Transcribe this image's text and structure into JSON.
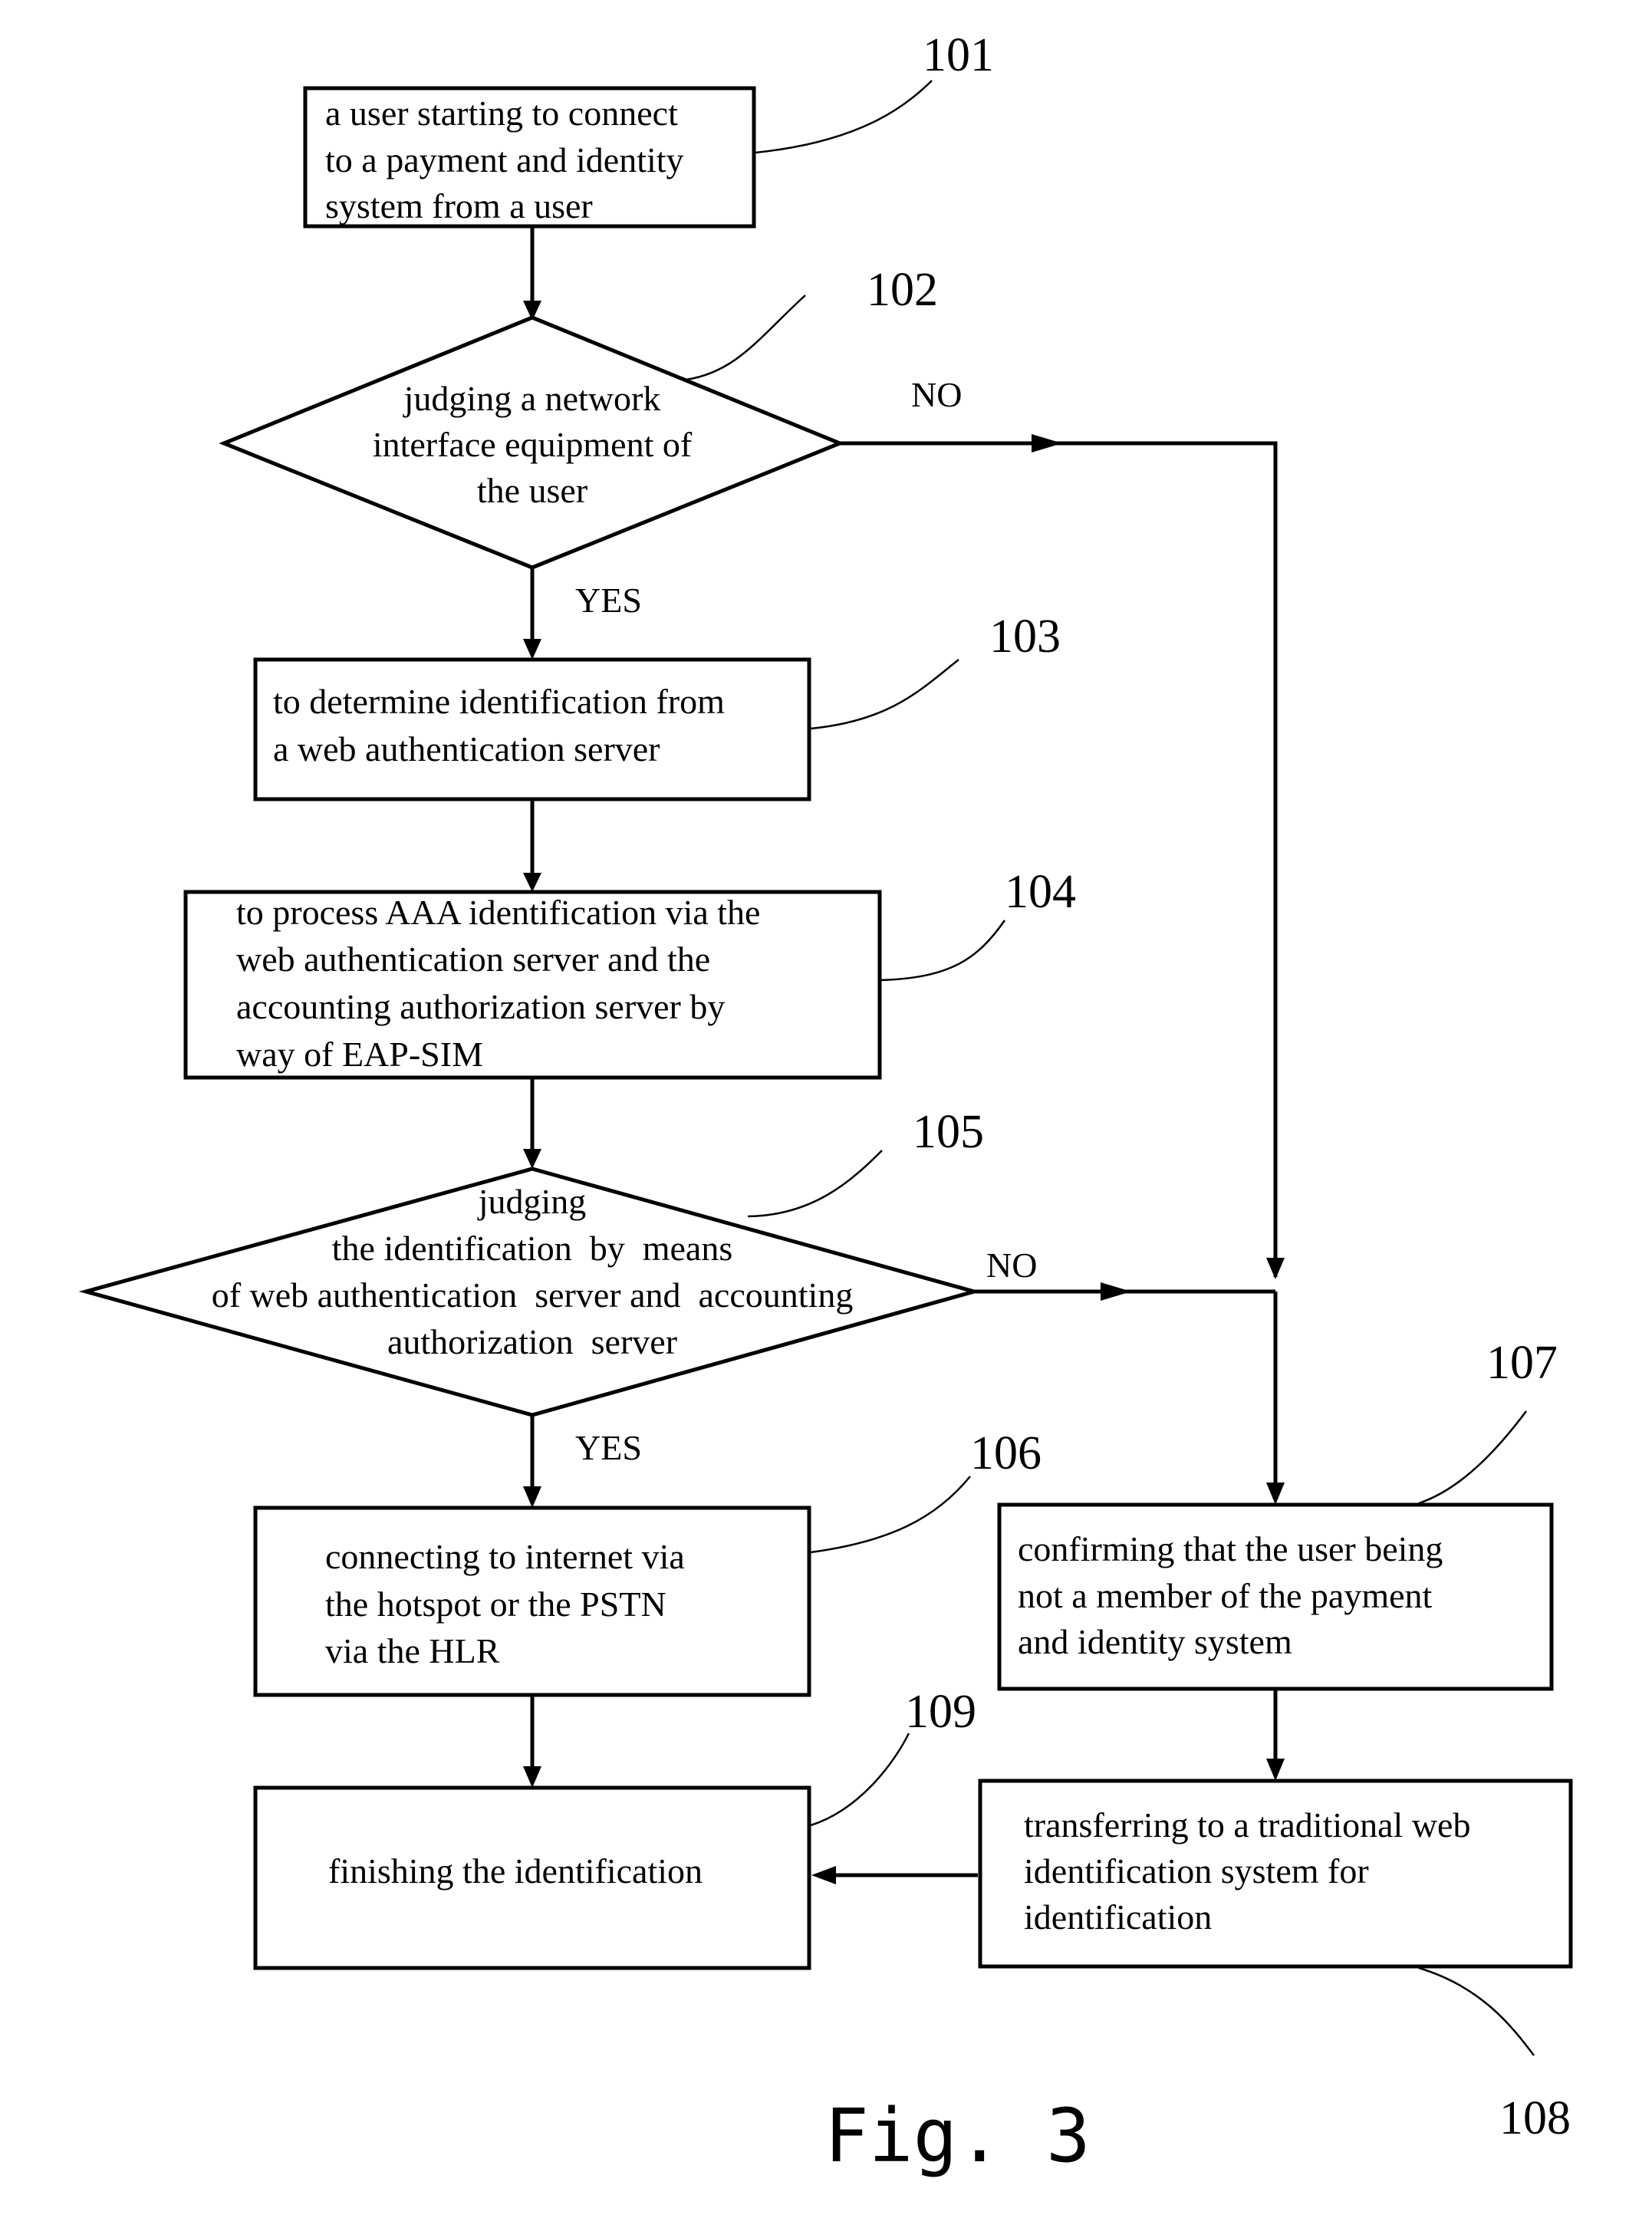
{
  "figure_label": "Fig. 3",
  "steps": {
    "s101": {
      "ref": "101",
      "lines": [
        "a user starting to connect",
        "to a payment and identity",
        "system from a user"
      ]
    },
    "s102": {
      "ref": "102",
      "lines": [
        "judging a network",
        "interface equipment of",
        "the user"
      ]
    },
    "s103": {
      "ref": "103",
      "lines": [
        "to determine identification from",
        "a web authentication server"
      ]
    },
    "s104": {
      "ref": "104",
      "lines": [
        "to process AAA identification via the",
        "web authentication server and the",
        "accounting authorization server by",
        "way of EAP-SIM"
      ]
    },
    "s105": {
      "ref": "105",
      "lines": [
        "judging",
        "the identification  by  means",
        "of web authentication  server and  accounting",
        "authorization  server"
      ]
    },
    "s106": {
      "ref": "106",
      "lines": [
        "connecting to internet via",
        "the hotspot or the PSTN",
        "via the HLR"
      ]
    },
    "s107": {
      "ref": "107",
      "lines": [
        "confirming that the user being",
        "not a member of the payment",
        "and identity system"
      ]
    },
    "s108": {
      "ref": "108",
      "lines": [
        "transferring to a traditional web",
        "identification system for",
        "identification"
      ]
    },
    "s109": {
      "ref": "109",
      "lines": [
        "finishing the identification"
      ]
    }
  },
  "branch_labels": {
    "d102_no": "NO",
    "d102_yes": "YES",
    "d105_no": "NO",
    "d105_yes": "YES"
  }
}
